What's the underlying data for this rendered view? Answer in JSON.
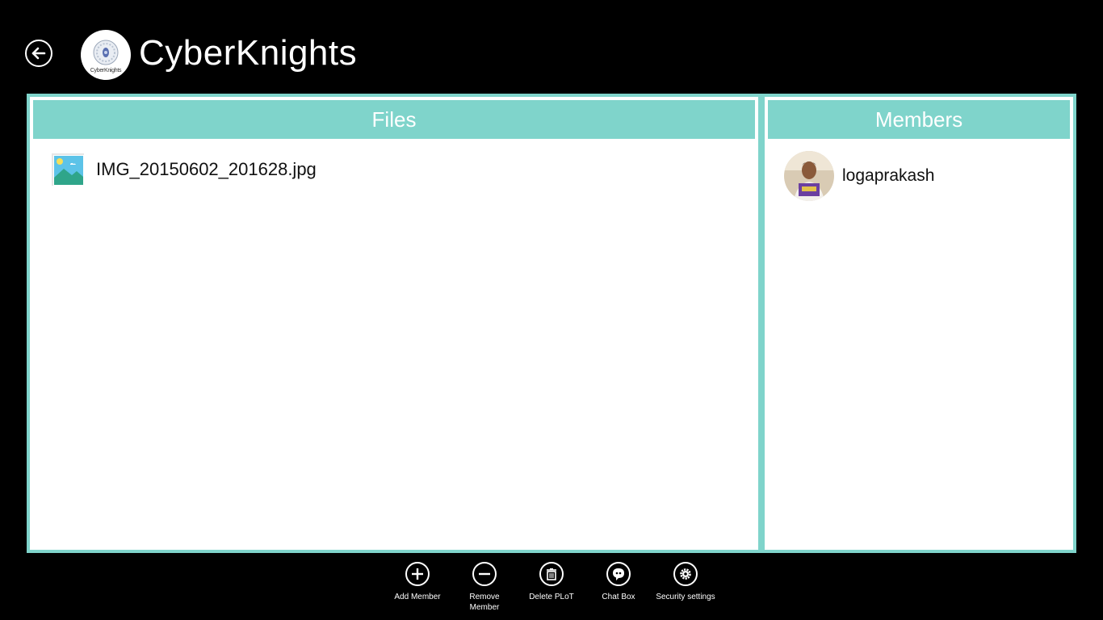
{
  "header": {
    "app_title": "CyberKnights",
    "logo_caption": "CyberKnights"
  },
  "files_panel": {
    "title": "Files",
    "items": [
      {
        "name": "IMG_20150602_201628.jpg",
        "icon": "image-file-icon"
      }
    ]
  },
  "members_panel": {
    "title": "Members",
    "items": [
      {
        "name": "logaprakash",
        "icon": "avatar"
      }
    ]
  },
  "app_bar": {
    "buttons": [
      {
        "label": "Add Member",
        "icon": "plus-icon"
      },
      {
        "label": "Remove\nMember",
        "icon": "minus-icon"
      },
      {
        "label": "Delete PLoT",
        "icon": "trash-icon"
      },
      {
        "label": "Chat Box",
        "icon": "chat-icon"
      },
      {
        "label": "Security settings",
        "icon": "gear-icon"
      }
    ]
  },
  "colors": {
    "background": "#000000",
    "accent": "#7fd4cb",
    "panel": "#ffffff",
    "text_dark": "#111111",
    "text_light": "#ffffff"
  }
}
